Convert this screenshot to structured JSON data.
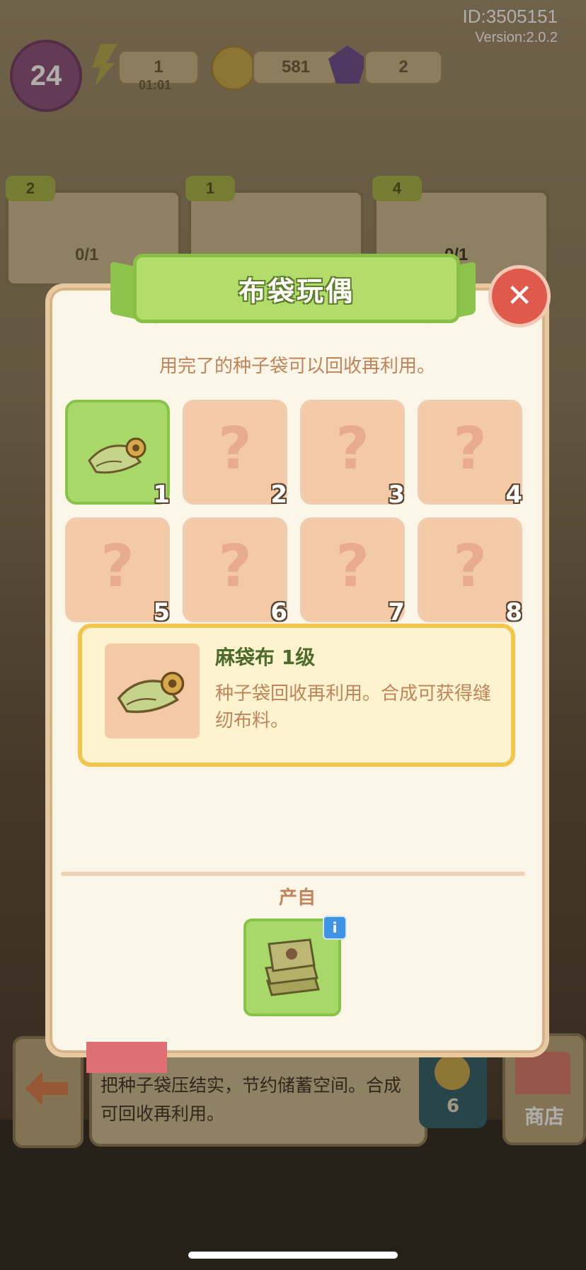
{
  "status": {
    "id": "ID:3505151",
    "version": "Version:2.0.2"
  },
  "hud": {
    "level": "24",
    "energy": {
      "value": "1",
      "timer": "01:01"
    },
    "coins": "581",
    "gems": "2"
  },
  "background": {
    "cards": [
      {
        "stars": "2",
        "progress": "0/1"
      },
      {
        "stars": "1",
        "progress": ""
      },
      {
        "stars": "4",
        "progress": "0/1"
      }
    ],
    "bottom_text": "把种子袋压结实，节约储蓄空间。合成可回收再利用。",
    "coin_count": "6",
    "shop_label": "商店"
  },
  "modal": {
    "title": "布袋玩偶",
    "subtitle": "用完了的种子袋可以回收再利用。",
    "close_icon": "close-icon",
    "grid": [
      {
        "num": "1",
        "unlocked": true,
        "icon": "burlap-cloth-icon"
      },
      {
        "num": "2",
        "unlocked": false,
        "mark": "?"
      },
      {
        "num": "3",
        "unlocked": false,
        "mark": "?"
      },
      {
        "num": "4",
        "unlocked": false,
        "mark": "?"
      },
      {
        "num": "5",
        "unlocked": false,
        "mark": "?"
      },
      {
        "num": "6",
        "unlocked": false,
        "mark": "?"
      },
      {
        "num": "7",
        "unlocked": false,
        "mark": "?"
      },
      {
        "num": "8",
        "unlocked": false,
        "mark": "?"
      }
    ],
    "selected_item": {
      "name": "麻袋布 1级",
      "description": "种子袋回收再利用。合成可获得缝纫布料。",
      "icon": "burlap-cloth-icon"
    },
    "source_label": "产自",
    "source_icon": "seed-bag-stack-icon",
    "source_info": "i"
  },
  "colors": {
    "accent_green": "#a8d86a",
    "locked_tile": "#f4c9a6",
    "close_red": "#e05a4c",
    "highlight_yellow": "#f3c54c"
  }
}
